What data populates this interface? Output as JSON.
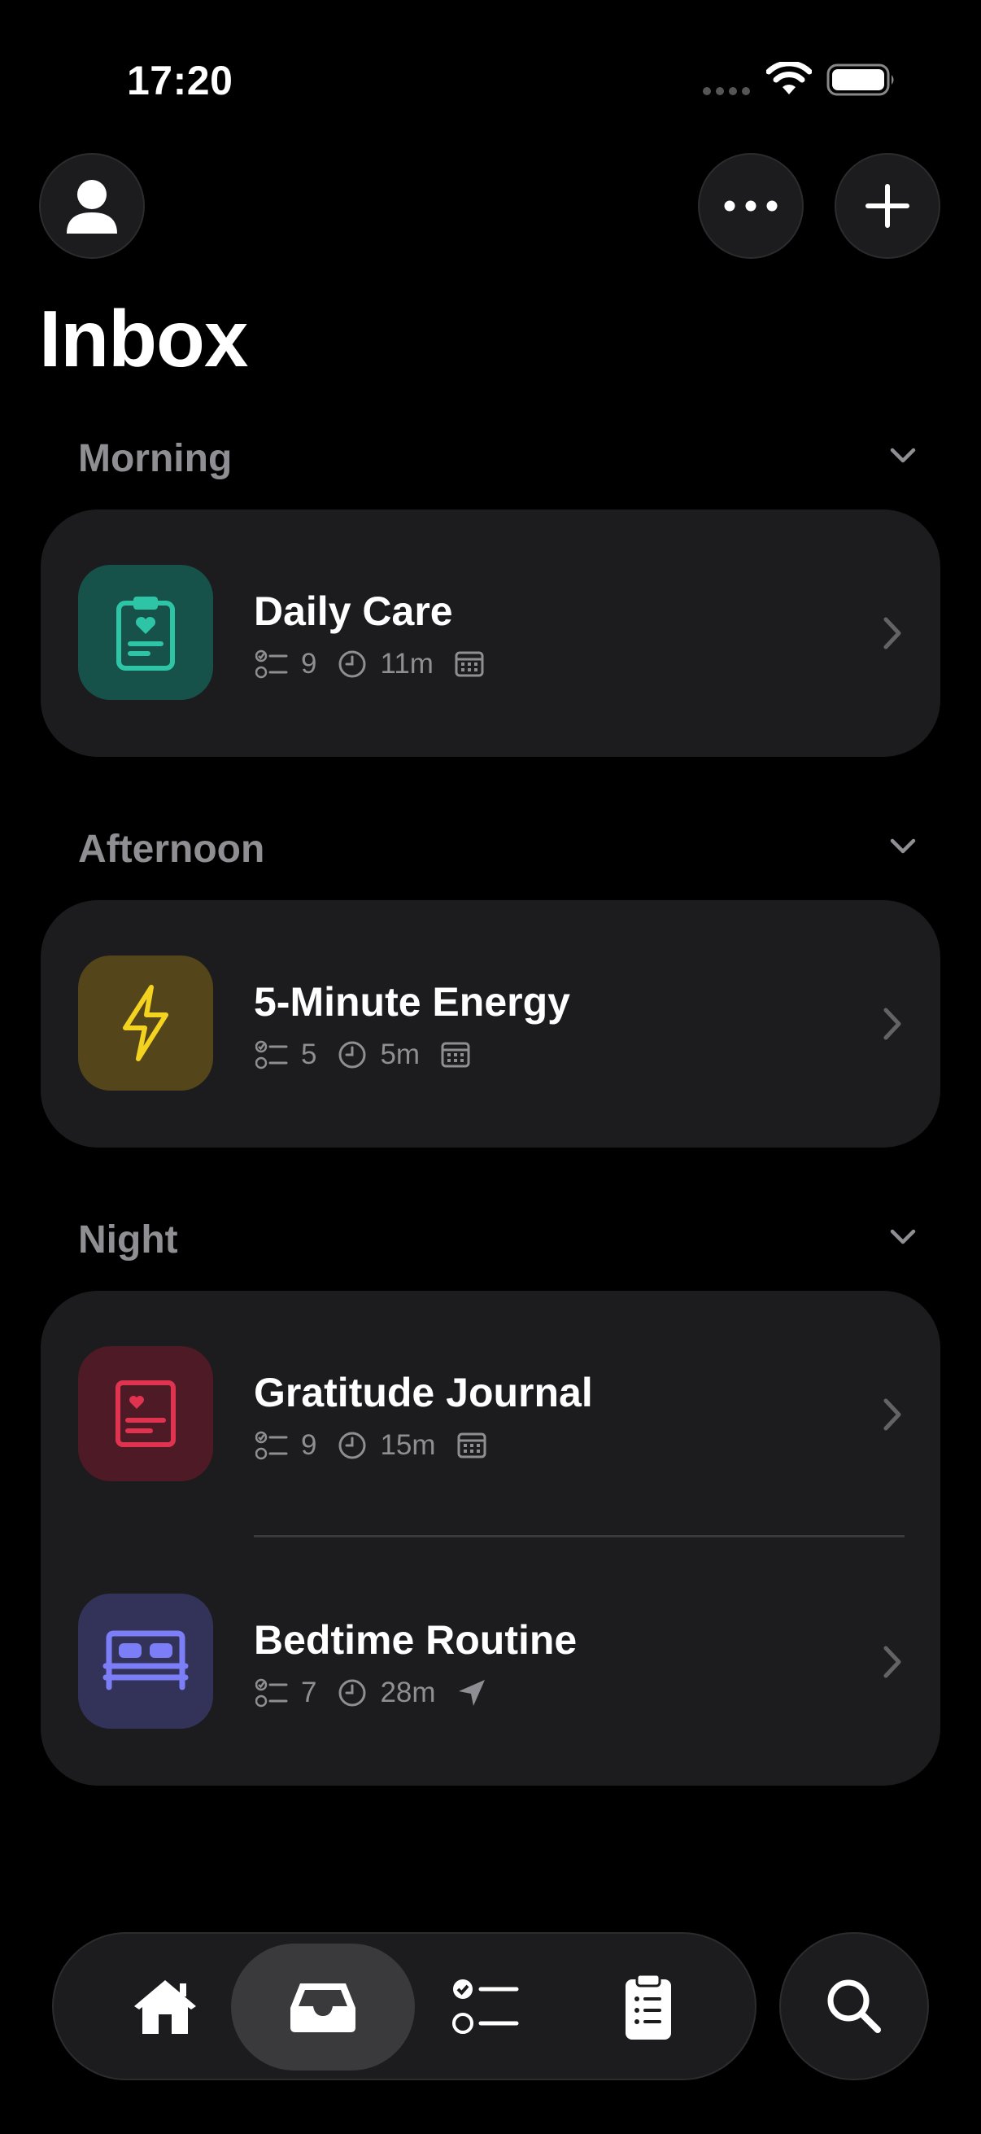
{
  "status_bar": {
    "time": "17:20",
    "icons": [
      "signal-dots-icon",
      "wifi-icon",
      "battery-icon"
    ]
  },
  "header": {
    "title": "Inbox",
    "buttons": [
      "profile-icon",
      "more-icon",
      "plus-icon"
    ]
  },
  "sections": [
    {
      "label": "Morning",
      "items": [
        {
          "name": "Daily Care",
          "tasks": "9",
          "duration": "11m",
          "trigger_icon": "calendar-icon",
          "icon": "clipboard-heart-icon",
          "tile_color": "#16524a",
          "icon_color": "#2ec4a6"
        }
      ]
    },
    {
      "label": "Afternoon",
      "items": [
        {
          "name": "5-Minute Energy",
          "tasks": "5",
          "duration": "5m",
          "trigger_icon": "calendar-icon",
          "icon": "lightning-icon",
          "tile_color": "#54461a",
          "icon_color": "#f4d320"
        }
      ]
    },
    {
      "label": "Night",
      "items": [
        {
          "name": "Gratitude Journal",
          "tasks": "9",
          "duration": "15m",
          "trigger_icon": "calendar-icon",
          "icon": "journal-heart-icon",
          "tile_color": "#4d1a25",
          "icon_color": "#e0334f"
        },
        {
          "name": "Bedtime Routine",
          "tasks": "7",
          "duration": "28m",
          "trigger_icon": "location-arrow-icon",
          "icon": "bed-icon",
          "tile_color": "#33335a",
          "icon_color": "#7b7ef7"
        }
      ]
    }
  ],
  "tab_bar": {
    "tabs": [
      "home-icon",
      "inbox-icon",
      "checklist-icon",
      "clipboard-list-icon"
    ],
    "active": "inbox-icon",
    "search": "search-icon"
  }
}
